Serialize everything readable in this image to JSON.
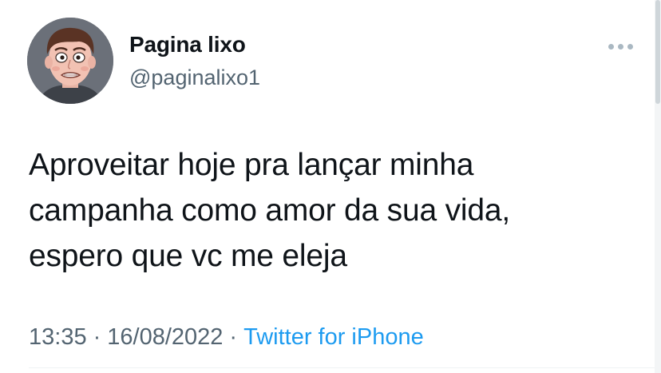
{
  "author": {
    "display_name": "Pagina lixo",
    "handle": "@paginalixo1",
    "avatar_icon": "cartoon-face-avatar"
  },
  "tweet": {
    "text_lines": [
      "Aproveitar hoje pra lançar minha",
      "campanha como amor da sua vida,",
      "espero que vc me eleja"
    ],
    "time": "13:35",
    "separator": "·",
    "date": "16/08/2022",
    "source": "Twitter for iPhone"
  },
  "menu": {
    "icon": "more-horizontal-icon"
  },
  "colors": {
    "text_primary": "#0f1419",
    "text_secondary": "#536471",
    "link": "#1d9bf0",
    "background": "#ffffff"
  }
}
